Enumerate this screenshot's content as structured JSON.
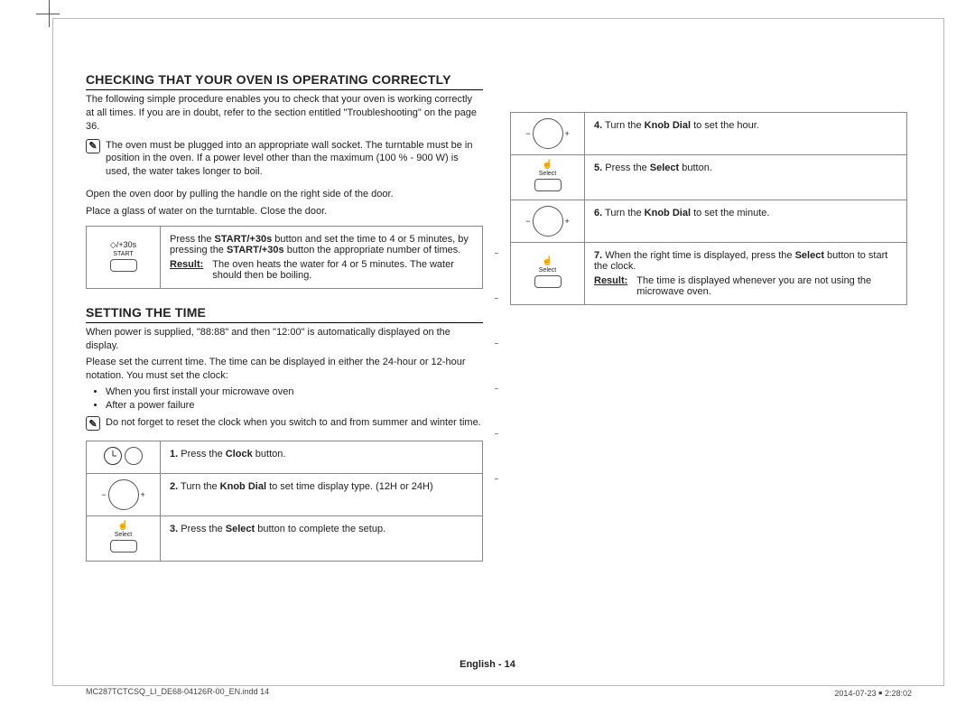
{
  "section1": {
    "title": "CHECKING THAT YOUR OVEN IS OPERATING CORRECTLY",
    "intro": "The following simple procedure enables you to check that your oven is working correctly at all times. If you are in doubt, refer to the section entitled \"Troubleshooting\" on the page 36.",
    "note": "The oven must be plugged into an appropriate wall socket. The turntable must be in position in the oven. If a power level other than the maximum (100 % - 900 W) is used, the water takes longer to boil.",
    "open1": "Open the oven door by pulling the handle on the right side of the door.",
    "open2": "Place a glass of water on the turntable. Close the door.",
    "start_icon": "/+30s",
    "start_label": "START",
    "procedure_a": "Press the ",
    "procedure_bold1": "START/+30s",
    "procedure_b": " button and set the time to 4 or 5 minutes, by pressing the ",
    "procedure_bold2": "START/+30s",
    "procedure_c": " button the appropriate number of times.",
    "result_label": "Result:",
    "result_text": "The oven heats the water for 4 or 5 minutes. The water should then be boiling."
  },
  "section2": {
    "title": "SETTING THE TIME",
    "intro1": "When power is supplied, \"88:88\" and then \"12:00\" is automatically displayed on the display.",
    "intro2": "Please set the current time. The time can be displayed in either the 24-hour or 12-hour notation. You must set the clock:",
    "bullet1": "When you first install your microwave oven",
    "bullet2": "After a power failure",
    "note": "Do not forget to reset the clock when you switch to and from summer and winter time.",
    "select_label": "Select",
    "steps": {
      "s1": {
        "n": "1.",
        "a": "Press the ",
        "b": "Clock",
        "c": " button."
      },
      "s2": {
        "n": "2.",
        "a": "Turn the ",
        "b": "Knob Dial",
        "c": " to set time display type. (12H or 24H)"
      },
      "s3": {
        "n": "3.",
        "a": "Press the ",
        "b": "Select",
        "c": " button to complete the setup."
      },
      "s4": {
        "n": "4.",
        "a": "Turn the ",
        "b": "Knob Dial",
        "c": " to set the hour."
      },
      "s5": {
        "n": "5.",
        "a": "Press the ",
        "b": "Select",
        "c": " button."
      },
      "s6": {
        "n": "6.",
        "a": "Turn the ",
        "b": "Knob Dial",
        "c": " to set the minute."
      },
      "s7": {
        "n": "7.",
        "a": "When the right time is displayed, press the ",
        "b": "Select",
        "c": " button to start the clock.",
        "result_label": "Result:",
        "result_text": "The time is displayed whenever you are not using the microwave oven."
      }
    }
  },
  "footer": "English - 14",
  "imprint_left": "MC287TCTCSQ_LI_DE68-04126R-00_EN.indd   14",
  "imprint_right": "2014-07-23   ￭ 2:28:02"
}
